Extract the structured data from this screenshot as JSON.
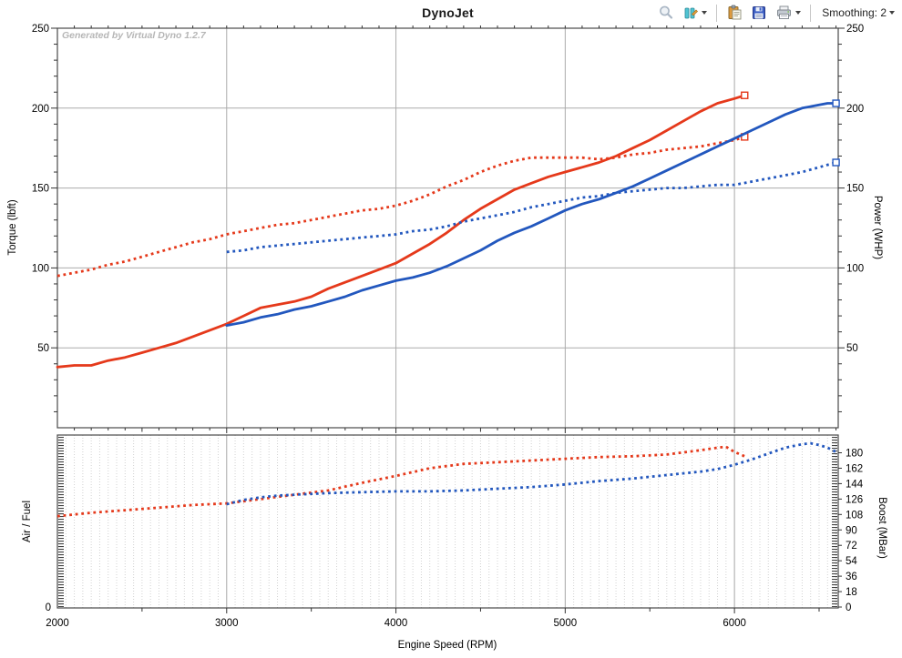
{
  "window": {
    "title": "DynoJet"
  },
  "toolbar": {
    "smoothing_label": "Smoothing: 2",
    "icons": [
      "zoom-icon",
      "graph-settings-icon",
      "copy-icon",
      "save-icon",
      "print-icon"
    ]
  },
  "watermark": "Generated by Virtual Dyno 1.2.7",
  "colors": {
    "run1": "#e5391b",
    "run2": "#2257be",
    "grid": "#ababab",
    "fine_grid": "#d2d2d2",
    "border": "#4a4a4a",
    "watermark": "#b6b6b6"
  },
  "chart_data": {
    "type": "line",
    "title": "DynoJet",
    "xlabel": "Engine Speed (RPM)",
    "xlim": [
      2000,
      6613
    ],
    "xticks": [
      2000,
      3000,
      4000,
      5000,
      6000
    ],
    "main_plot": {
      "ylabel_left": "Torque (lbft)",
      "ylabel_right": "Power (WHP)",
      "ylim": [
        0,
        250
      ],
      "yticks": [
        50,
        100,
        150,
        200,
        250
      ],
      "grid": "on",
      "series": [
        {
          "name": "run1-power-whp",
          "color": "#e5391b",
          "style": "solid",
          "end_marker": true,
          "points": [
            [
              2000,
              38
            ],
            [
              2100,
              39
            ],
            [
              2200,
              39
            ],
            [
              2300,
              42
            ],
            [
              2400,
              44
            ],
            [
              2500,
              47
            ],
            [
              2600,
              50
            ],
            [
              2700,
              53
            ],
            [
              2800,
              57
            ],
            [
              2900,
              61
            ],
            [
              3000,
              65
            ],
            [
              3100,
              70
            ],
            [
              3200,
              75
            ],
            [
              3300,
              77
            ],
            [
              3400,
              79
            ],
            [
              3500,
              82
            ],
            [
              3600,
              87
            ],
            [
              3700,
              91
            ],
            [
              3800,
              95
            ],
            [
              3900,
              99
            ],
            [
              4000,
              103
            ],
            [
              4100,
              109
            ],
            [
              4200,
              115
            ],
            [
              4300,
              122
            ],
            [
              4400,
              130
            ],
            [
              4500,
              137
            ],
            [
              4600,
              143
            ],
            [
              4700,
              149
            ],
            [
              4800,
              153
            ],
            [
              4900,
              157
            ],
            [
              5000,
              160
            ],
            [
              5100,
              163
            ],
            [
              5200,
              166
            ],
            [
              5300,
              170
            ],
            [
              5400,
              175
            ],
            [
              5500,
              180
            ],
            [
              5600,
              186
            ],
            [
              5700,
              192
            ],
            [
              5800,
              198
            ],
            [
              5900,
              203
            ],
            [
              6000,
              206
            ],
            [
              6060,
              208
            ]
          ]
        },
        {
          "name": "run1-torque-lbft",
          "color": "#e5391b",
          "style": "dotted",
          "end_marker": true,
          "points": [
            [
              2000,
              95
            ],
            [
              2100,
              97
            ],
            [
              2200,
              99
            ],
            [
              2300,
              102
            ],
            [
              2400,
              104
            ],
            [
              2500,
              107
            ],
            [
              2600,
              110
            ],
            [
              2700,
              113
            ],
            [
              2800,
              116
            ],
            [
              2900,
              118
            ],
            [
              3000,
              121
            ],
            [
              3100,
              123
            ],
            [
              3200,
              125
            ],
            [
              3300,
              127
            ],
            [
              3400,
              128
            ],
            [
              3500,
              130
            ],
            [
              3600,
              132
            ],
            [
              3700,
              134
            ],
            [
              3800,
              136
            ],
            [
              3900,
              137
            ],
            [
              4000,
              139
            ],
            [
              4100,
              142
            ],
            [
              4200,
              146
            ],
            [
              4300,
              151
            ],
            [
              4400,
              155
            ],
            [
              4500,
              160
            ],
            [
              4600,
              164
            ],
            [
              4700,
              167
            ],
            [
              4800,
              169
            ],
            [
              4900,
              169
            ],
            [
              5000,
              169
            ],
            [
              5100,
              169
            ],
            [
              5200,
              168
            ],
            [
              5300,
              169
            ],
            [
              5400,
              171
            ],
            [
              5500,
              172
            ],
            [
              5600,
              174
            ],
            [
              5700,
              175
            ],
            [
              5800,
              176
            ],
            [
              5900,
              178
            ],
            [
              6000,
              180
            ],
            [
              6060,
              182
            ]
          ]
        },
        {
          "name": "run2-power-whp",
          "color": "#2257be",
          "style": "solid",
          "end_marker": true,
          "points": [
            [
              3000,
              64
            ],
            [
              3100,
              66
            ],
            [
              3200,
              69
            ],
            [
              3300,
              71
            ],
            [
              3400,
              74
            ],
            [
              3500,
              76
            ],
            [
              3600,
              79
            ],
            [
              3700,
              82
            ],
            [
              3800,
              86
            ],
            [
              3900,
              89
            ],
            [
              4000,
              92
            ],
            [
              4100,
              94
            ],
            [
              4200,
              97
            ],
            [
              4300,
              101
            ],
            [
              4400,
              106
            ],
            [
              4500,
              111
            ],
            [
              4600,
              117
            ],
            [
              4700,
              122
            ],
            [
              4800,
              126
            ],
            [
              4900,
              131
            ],
            [
              5000,
              136
            ],
            [
              5100,
              140
            ],
            [
              5200,
              143
            ],
            [
              5300,
              147
            ],
            [
              5400,
              151
            ],
            [
              5500,
              156
            ],
            [
              5600,
              161
            ],
            [
              5700,
              166
            ],
            [
              5800,
              171
            ],
            [
              5900,
              176
            ],
            [
              6000,
              181
            ],
            [
              6100,
              186
            ],
            [
              6200,
              191
            ],
            [
              6300,
              196
            ],
            [
              6400,
              200
            ],
            [
              6500,
              202
            ],
            [
              6550,
              203
            ],
            [
              6600,
              203
            ]
          ]
        },
        {
          "name": "run2-torque-lbft",
          "color": "#2257be",
          "style": "dotted",
          "end_marker": true,
          "points": [
            [
              3000,
              110
            ],
            [
              3100,
              111
            ],
            [
              3200,
              113
            ],
            [
              3300,
              114
            ],
            [
              3400,
              115
            ],
            [
              3500,
              116
            ],
            [
              3600,
              117
            ],
            [
              3700,
              118
            ],
            [
              3800,
              119
            ],
            [
              3900,
              120
            ],
            [
              4000,
              121
            ],
            [
              4100,
              123
            ],
            [
              4200,
              124
            ],
            [
              4300,
              126
            ],
            [
              4400,
              129
            ],
            [
              4500,
              131
            ],
            [
              4600,
              133
            ],
            [
              4700,
              135
            ],
            [
              4800,
              138
            ],
            [
              4900,
              140
            ],
            [
              5000,
              142
            ],
            [
              5100,
              144
            ],
            [
              5200,
              145
            ],
            [
              5300,
              147
            ],
            [
              5400,
              148
            ],
            [
              5500,
              149
            ],
            [
              5600,
              150
            ],
            [
              5700,
              150
            ],
            [
              5800,
              151
            ],
            [
              5900,
              152
            ],
            [
              6000,
              152
            ],
            [
              6100,
              154
            ],
            [
              6200,
              156
            ],
            [
              6300,
              158
            ],
            [
              6400,
              160
            ],
            [
              6500,
              163
            ],
            [
              6600,
              166
            ]
          ]
        }
      ]
    },
    "bottom_plot": {
      "ylabel_left": "Air / Fuel",
      "ylabel_right": "Boost (MBar)",
      "ylim_right": [
        0,
        201
      ],
      "yticks_right": [
        0,
        18,
        36,
        54,
        72,
        90,
        108,
        126,
        144,
        162,
        180
      ],
      "afr_zero_label": "0",
      "grid": "fine-dotted",
      "series": [
        {
          "name": "run1-boost-mbar",
          "color": "#e5391b",
          "style": "dotted",
          "end_marker": false,
          "points": [
            [
              2000,
              106
            ],
            [
              2200,
              110
            ],
            [
              2400,
              113
            ],
            [
              2600,
              116
            ],
            [
              2800,
              119
            ],
            [
              3000,
              121
            ],
            [
              3200,
              126
            ],
            [
              3400,
              131
            ],
            [
              3600,
              136
            ],
            [
              3800,
              145
            ],
            [
              4000,
              153
            ],
            [
              4200,
              162
            ],
            [
              4400,
              167
            ],
            [
              4600,
              169
            ],
            [
              4800,
              171
            ],
            [
              5000,
              173
            ],
            [
              5200,
              175
            ],
            [
              5400,
              176
            ],
            [
              5600,
              178
            ],
            [
              5800,
              183
            ],
            [
              5900,
              186
            ],
            [
              5950,
              187
            ],
            [
              6000,
              181
            ],
            [
              6060,
              176
            ]
          ]
        },
        {
          "name": "run2-boost-mbar",
          "color": "#2257be",
          "style": "dotted",
          "end_marker": false,
          "points": [
            [
              3000,
              120
            ],
            [
              3100,
              125
            ],
            [
              3200,
              128
            ],
            [
              3300,
              130
            ],
            [
              3400,
              131
            ],
            [
              3600,
              133
            ],
            [
              3800,
              134
            ],
            [
              4000,
              135
            ],
            [
              4200,
              135
            ],
            [
              4400,
              136
            ],
            [
              4600,
              138
            ],
            [
              4800,
              140
            ],
            [
              5000,
              143
            ],
            [
              5200,
              147
            ],
            [
              5400,
              150
            ],
            [
              5600,
              154
            ],
            [
              5800,
              158
            ],
            [
              5900,
              161
            ],
            [
              6000,
              166
            ],
            [
              6100,
              172
            ],
            [
              6200,
              179
            ],
            [
              6300,
              186
            ],
            [
              6400,
              190
            ],
            [
              6450,
              191
            ],
            [
              6500,
              189
            ],
            [
              6550,
              186
            ],
            [
              6600,
              181
            ]
          ]
        }
      ]
    }
  }
}
